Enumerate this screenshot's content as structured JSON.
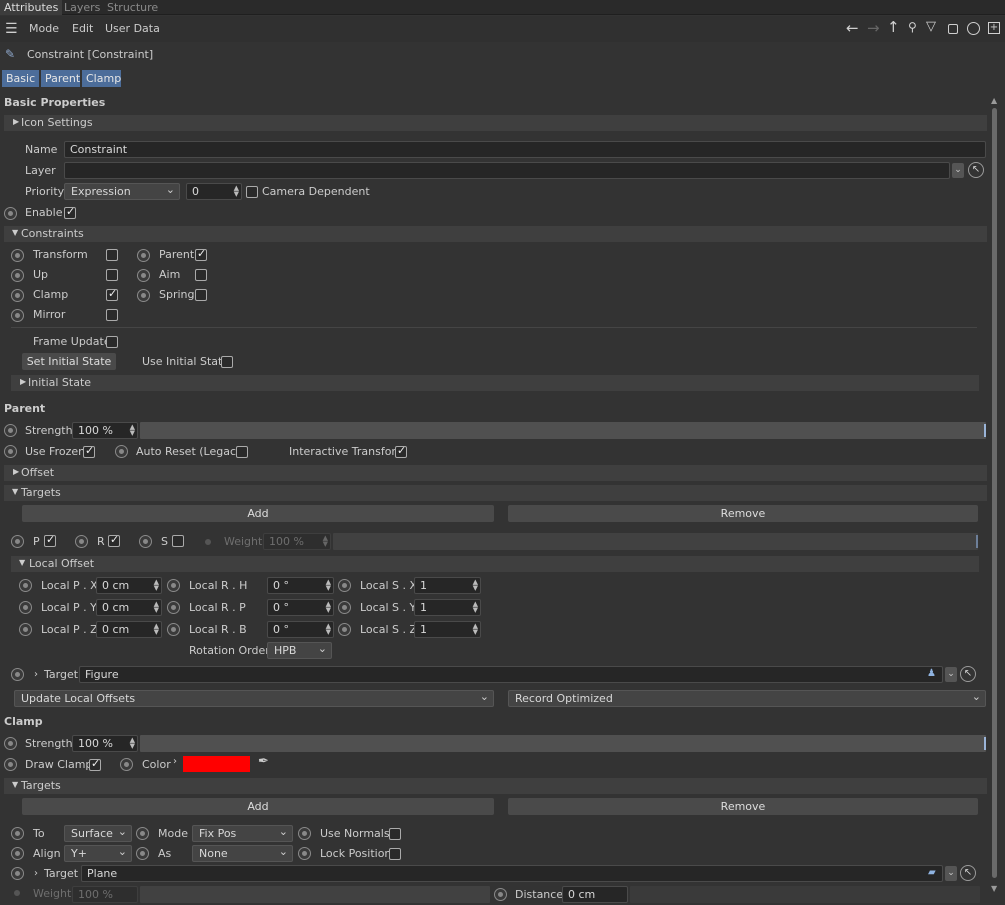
{
  "tabs": [
    {
      "label": "Attributes"
    },
    {
      "label": "Layers"
    },
    {
      "label": "Structure"
    }
  ],
  "menu": {
    "mode": "Mode",
    "edit": "Edit",
    "user_data": "User Data"
  },
  "toolbar_icons": [
    "arrow-left-icon",
    "arrow-right-icon",
    "arrow-up-icon",
    "search-icon",
    "filter-icon",
    "lock-icon",
    "target-icon",
    "new-panel-icon"
  ],
  "header": {
    "title": "Constraint [Constraint]"
  },
  "section_buttons": {
    "basic": "Basic",
    "parent": "Parent",
    "clamp": "Clamp"
  },
  "basic": {
    "title": "Basic Properties",
    "icon_settings": "Icon Settings",
    "name_label": "Name",
    "name_value": "Constraint",
    "layer_label": "Layer",
    "layer_value": "",
    "priority_label": "Priority",
    "priority_value": "Expression",
    "priority_number": "0",
    "camera_dependent": "Camera Dependent",
    "camera_dependent_checked": false,
    "enable_label": "Enable",
    "enable_checked": true
  },
  "constraints": {
    "title": "Constraints",
    "items": [
      {
        "label": "Transform",
        "checked": false
      },
      {
        "label": "Parent",
        "checked": true
      },
      {
        "label": "Up",
        "checked": false
      },
      {
        "label": "Aim",
        "checked": false
      },
      {
        "label": "Clamp",
        "checked": true
      },
      {
        "label": "Spring",
        "checked": false
      },
      {
        "label": "Mirror",
        "checked": false
      }
    ],
    "frame_update": "Frame Update",
    "frame_update_checked": false,
    "set_initial_state": "Set Initial State",
    "use_initial_state": "Use Initial State",
    "use_initial_state_checked": false,
    "initial_state": "Initial State"
  },
  "parent": {
    "title": "Parent",
    "strength_label": "Strength",
    "strength_value": "100 %",
    "strength_fraction": 1.0,
    "use_frozen": "Use Frozen",
    "use_frozen_checked": true,
    "auto_reset": "Auto Reset (Legacy)",
    "auto_reset_checked": false,
    "interactive_transform": "Interactive Transform",
    "interactive_transform_checked": true,
    "offset": "Offset",
    "targets": "Targets",
    "add": "Add",
    "remove": "Remove",
    "p": "P",
    "p_checked": true,
    "r": "R",
    "r_checked": true,
    "s": "S",
    "s_checked": false,
    "weight_label": "Weight",
    "weight_value": "100 %",
    "local_offset": "Local Offset",
    "offset_rows": [
      {
        "p_label": "Local P . X",
        "p_value": "0 cm",
        "r_label": "Local R . H",
        "r_value": "0 °",
        "s_label": "Local S . X",
        "s_value": "1"
      },
      {
        "p_label": "Local P . Y",
        "p_value": "0 cm",
        "r_label": "Local R . P",
        "r_value": "0 °",
        "s_label": "Local S . Y",
        "s_value": "1"
      },
      {
        "p_label": "Local P . Z",
        "p_value": "0 cm",
        "r_label": "Local R . B",
        "r_value": "0 °",
        "s_label": "Local S . Z",
        "s_value": "1"
      }
    ],
    "rotation_order_label": "Rotation Order",
    "rotation_order_value": "HPB",
    "target_label": "Target",
    "target_value": "Figure",
    "update_local_offsets": "Update Local Offsets",
    "record_optimized": "Record Optimized"
  },
  "clamp": {
    "title": "Clamp",
    "strength_label": "Strength",
    "strength_value": "100 %",
    "strength_fraction": 1.0,
    "draw_clamp": "Draw Clamp",
    "draw_clamp_checked": true,
    "color_label": "Color",
    "color_value": "#ff0000",
    "targets": "Targets",
    "add": "Add",
    "remove": "Remove",
    "to_label": "To",
    "to_value": "Surface",
    "mode_label": "Mode",
    "mode_value": "Fix Pos",
    "use_normals": "Use Normals",
    "use_normals_checked": false,
    "align_label": "Align",
    "align_value": "Y+",
    "as_label": "As",
    "as_value": "None",
    "lock_position": "Lock Position",
    "lock_position_checked": false,
    "target_label": "Target",
    "target_value": "Plane",
    "weight_label": "Weight",
    "weight_value": "100 %",
    "distance_label": "Distance",
    "distance_value": "0 cm"
  }
}
